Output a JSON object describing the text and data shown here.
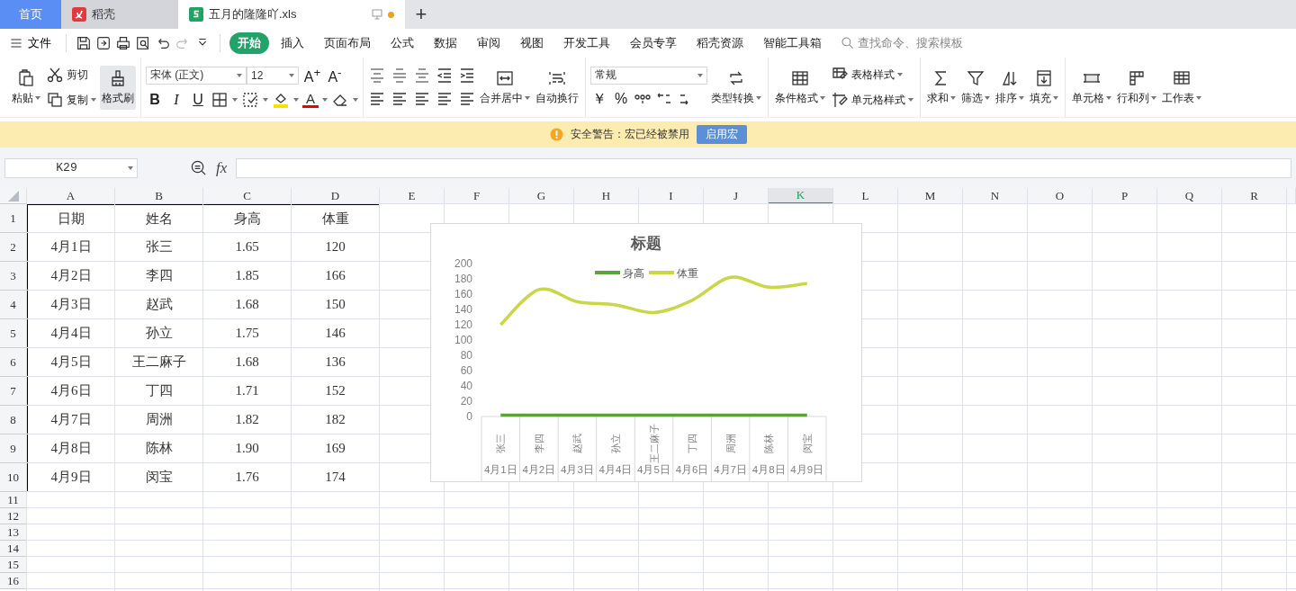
{
  "tab_bar": {
    "tabs": [
      {
        "label": "首页",
        "kind": "home",
        "selected": false
      },
      {
        "label": "稻壳",
        "kind": "app",
        "selected": false
      },
      {
        "label": "五月的隆隆吖.xls",
        "kind": "file",
        "selected": true,
        "unsaved": true
      }
    ],
    "new_tab": "+"
  },
  "menu_bar": {
    "file_menu": "文件",
    "tabs": [
      {
        "label": "开始",
        "selected": true
      },
      {
        "label": "插入",
        "selected": false
      },
      {
        "label": "页面布局",
        "selected": false
      },
      {
        "label": "公式",
        "selected": false
      },
      {
        "label": "数据",
        "selected": false
      },
      {
        "label": "审阅",
        "selected": false
      },
      {
        "label": "视图",
        "selected": false
      },
      {
        "label": "开发工具",
        "selected": false
      },
      {
        "label": "会员专享",
        "selected": false
      },
      {
        "label": "稻壳资源",
        "selected": false
      },
      {
        "label": "智能工具箱",
        "selected": false
      }
    ],
    "search": {
      "placeholder": "查找命令、搜索模板"
    }
  },
  "ribbon": {
    "clipboard": {
      "paste": "粘贴",
      "cut": "剪切",
      "copy": "复制",
      "format_painter": {
        "label": "格式刷",
        "active": true
      }
    },
    "font": {
      "font_name": "宋体 (正文)",
      "font_size": "12",
      "size_buttons": [
        "A$^{+}$",
        "A$^{-}$"
      ],
      "style_buttons": [
        "B",
        "I",
        "U"
      ],
      "font_color": "A"
    },
    "alignment": {
      "merge": "合并居中",
      "wrap": "自动换行"
    },
    "number": {
      "format": "常规",
      "symbols": [
        "￥",
        "%"
      ],
      "convert": "类型转换"
    },
    "styles": {
      "conditional": "条件格式",
      "table_style": "表格样式",
      "cell_style": "单元格样式"
    },
    "editing": [
      "求和",
      "筛选",
      "排序",
      "填充"
    ],
    "cells": [
      "单元格",
      "行和列",
      "工作表"
    ]
  },
  "security_bar": {
    "message": "安全警告：宏已经被禁用",
    "button": "启用宏"
  },
  "formula_bar": {
    "name_box": "K29",
    "function_label": "fx"
  },
  "sheet": {
    "columns": [
      {
        "label": "A",
        "selected": false
      },
      {
        "label": "B",
        "selected": false
      },
      {
        "label": "C",
        "selected": false
      },
      {
        "label": "D",
        "selected": false
      },
      {
        "label": "E",
        "selected": false
      },
      {
        "label": "F",
        "selected": false
      },
      {
        "label": "G",
        "selected": false
      },
      {
        "label": "H",
        "selected": false
      },
      {
        "label": "I",
        "selected": false
      },
      {
        "label": "J",
        "selected": false
      },
      {
        "label": "K",
        "selected": true
      },
      {
        "label": "L",
        "selected": false
      },
      {
        "label": "M",
        "selected": false
      },
      {
        "label": "N",
        "selected": false
      },
      {
        "label": "O",
        "selected": false
      },
      {
        "label": "P",
        "selected": false
      },
      {
        "label": "Q",
        "selected": false
      },
      {
        "label": "R",
        "selected": false
      }
    ],
    "rows": [
      {
        "number": "1",
        "cells": [
          "日期",
          "姓名",
          "身高",
          "体重"
        ]
      },
      {
        "number": "2",
        "cells": [
          "4月1日",
          "张三",
          "1.65",
          "120"
        ]
      },
      {
        "number": "3",
        "cells": [
          "4月2日",
          "李四",
          "1.85",
          "166"
        ]
      },
      {
        "number": "4",
        "cells": [
          "4月3日",
          "赵武",
          "1.68",
          "150"
        ]
      },
      {
        "number": "5",
        "cells": [
          "4月4日",
          "孙立",
          "1.75",
          "146"
        ]
      },
      {
        "number": "6",
        "cells": [
          "4月5日",
          "王二麻子",
          "1.68",
          "136"
        ]
      },
      {
        "number": "7",
        "cells": [
          "4月6日",
          "丁四",
          "1.71",
          "152"
        ]
      },
      {
        "number": "8",
        "cells": [
          "4月7日",
          "周洲",
          "1.82",
          "182"
        ]
      },
      {
        "number": "9",
        "cells": [
          "4月8日",
          "陈林",
          "1.90",
          "169"
        ]
      },
      {
        "number": "10",
        "cells": [
          "4月9日",
          "闵宝",
          "1.76",
          "174"
        ]
      },
      {
        "number": "11"
      },
      {
        "number": "12"
      },
      {
        "number": "13"
      },
      {
        "number": "14"
      },
      {
        "number": "15"
      },
      {
        "number": "16"
      }
    ],
    "chart": {
      "category_names": [
        "张三",
        "李四",
        "赵武",
        "孙立",
        "王二麻子",
        "丁四",
        "周洲",
        "陈林",
        "闵宝"
      ],
      "chart_data": {
        "type": "line",
        "title": "标题",
        "categories": [
          "4月1日",
          "4月2日",
          "4月3日",
          "4月4日",
          "4月5日",
          "4月6日",
          "4月7日",
          "4月8日",
          "4月9日"
        ],
        "series": [
          {
            "name": "身高",
            "color": "#5aa33a",
            "values": [
              1.65,
              1.85,
              1.68,
              1.75,
              1.68,
              1.71,
              1.82,
              1.9,
              1.76
            ]
          },
          {
            "name": "体重",
            "color": "#c9d648",
            "values": [
              120,
              166,
              150,
              146,
              136,
              152,
              182,
              169,
              174
            ]
          }
        ],
        "legend": true,
        "ylim": [
          0,
          200
        ],
        "yticks": [
          {
            "value": 0,
            "label": "0"
          },
          {
            "value": 20,
            "label": "20"
          },
          {
            "value": 40,
            "label": "40"
          },
          {
            "value": 60,
            "label": "60"
          },
          {
            "value": 80,
            "label": "80"
          },
          {
            "value": 100,
            "label": "100"
          },
          {
            "value": 120,
            "label": "120"
          },
          {
            "value": 140,
            "label": "140"
          },
          {
            "value": 160,
            "label": "160"
          },
          {
            "value": 180,
            "label": "180"
          },
          {
            "value": 200,
            "label": "200"
          }
        ]
      }
    }
  }
}
